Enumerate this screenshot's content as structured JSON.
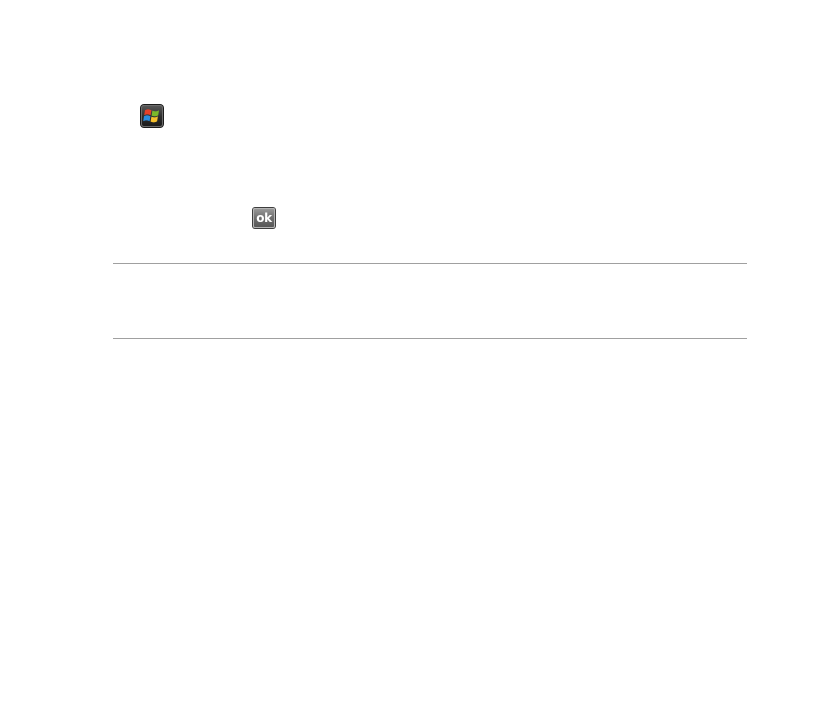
{
  "start_button": {
    "icon": "windows-flag-icon"
  },
  "ok_button": {
    "label": "ok"
  },
  "colors": {
    "flag_red": "#e8412a",
    "flag_green": "#7bb92a",
    "flag_blue": "#2d8ee0",
    "flag_yellow": "#f6c02c",
    "button_dark": "#2c2c2c",
    "button_gray": "#6e6e6e",
    "rule": "#a0a0a0"
  }
}
